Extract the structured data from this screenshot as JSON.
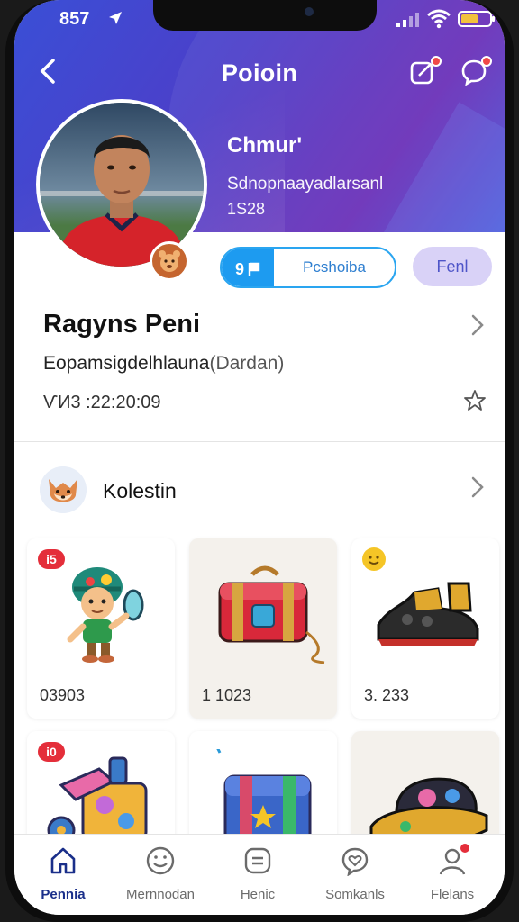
{
  "status": {
    "time": "857",
    "battery_color": "#f2c23c"
  },
  "nav": {
    "title": "Poioin",
    "back_icon": "chevron-left-icon",
    "action_icons": [
      "edit-icon",
      "chat-icon"
    ]
  },
  "hero": {
    "name": "Chmur'",
    "subtitle": "Sdnopnaayadlarsanl",
    "number": "1S28",
    "gradient": [
      "#3a4fd6",
      "#6a2fb8"
    ]
  },
  "actions": {
    "split_left": "9",
    "split_right": "Pcshoiba",
    "pill": "Fenl"
  },
  "profile": {
    "name": "Ragyns Peni",
    "desc_main": "Eopamsigdelhlauna",
    "desc_muted": "(Dardan)",
    "time": "ѴИ3 :22:20:09"
  },
  "collection": {
    "label": "Kolestin"
  },
  "cards": [
    {
      "tag": "i5",
      "value": "03903",
      "icon": "helmet-kid-icon"
    },
    {
      "value": "1  1023",
      "icon": "treasure-chest-icon"
    },
    {
      "value": "3. 233",
      "icon": "sneaker-icon"
    },
    {
      "tag": "i0",
      "value": "",
      "icon": "toy-blocks-icon"
    },
    {
      "value": "",
      "icon": "gift-box-icon"
    },
    {
      "value": "",
      "icon": "cap-icon"
    }
  ],
  "tabs": [
    {
      "label": "Pennia",
      "icon": "home-icon",
      "active": true
    },
    {
      "label": "Mernnodan",
      "icon": "smile-icon",
      "active": false
    },
    {
      "label": "Henic",
      "icon": "card-icon",
      "active": false
    },
    {
      "label": "Somkanls",
      "icon": "heart-chat-icon",
      "active": false
    },
    {
      "label": "Flelans",
      "icon": "person-icon",
      "active": false
    }
  ]
}
